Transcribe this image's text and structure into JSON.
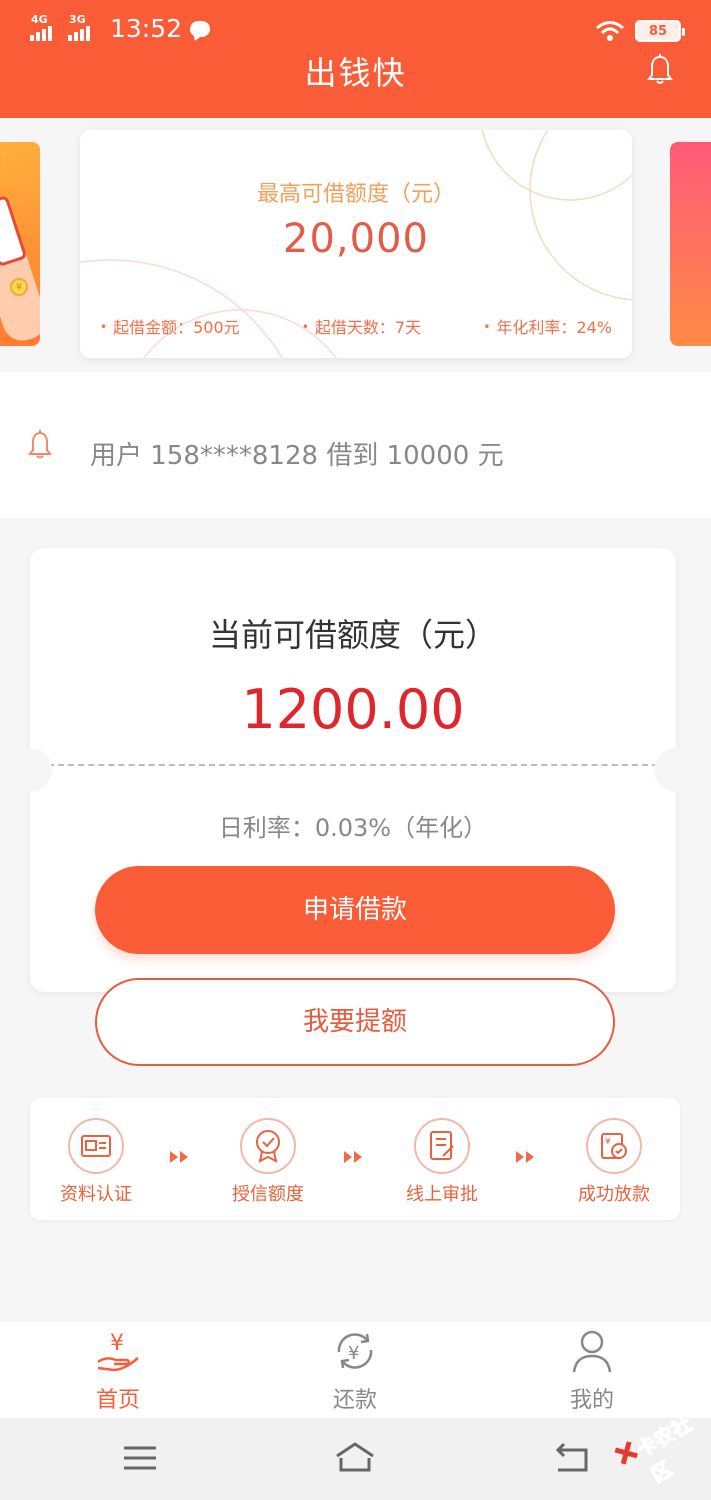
{
  "status_bar": {
    "net1": "4G",
    "net2": "3G",
    "time": "13:52",
    "battery": "85"
  },
  "header": {
    "title": "出钱快"
  },
  "banner": {
    "title": "最高可借额度（元）",
    "amount": "20,000",
    "terms": [
      "起借金额：500元",
      "起借天数：7天",
      "年化利率：24%"
    ]
  },
  "notice": {
    "text": "用户 158****8128 借到 10000 元"
  },
  "credit": {
    "title": "当前可借额度（元）",
    "amount": "1200.00",
    "rate": "日利率：0.03%（年化）",
    "apply_label": "申请借款",
    "raise_label": "我要提额"
  },
  "steps": [
    {
      "label": "资料认证",
      "icon": "id-card-icon"
    },
    {
      "label": "授信额度",
      "icon": "badge-check-icon"
    },
    {
      "label": "线上审批",
      "icon": "document-edit-icon"
    },
    {
      "label": "成功放款",
      "icon": "money-check-icon"
    }
  ],
  "tabs": [
    {
      "label": "首页",
      "icon": "home-loan-icon",
      "active": true
    },
    {
      "label": "还款",
      "icon": "repay-cycle-icon",
      "active": false
    },
    {
      "label": "我的",
      "icon": "user-icon",
      "active": false
    }
  ],
  "watermark": {
    "text": "卡农社区"
  },
  "colors": {
    "brand": "#fa5c38",
    "amount_red": "#e0262d",
    "step_orange": "#e8623e"
  }
}
